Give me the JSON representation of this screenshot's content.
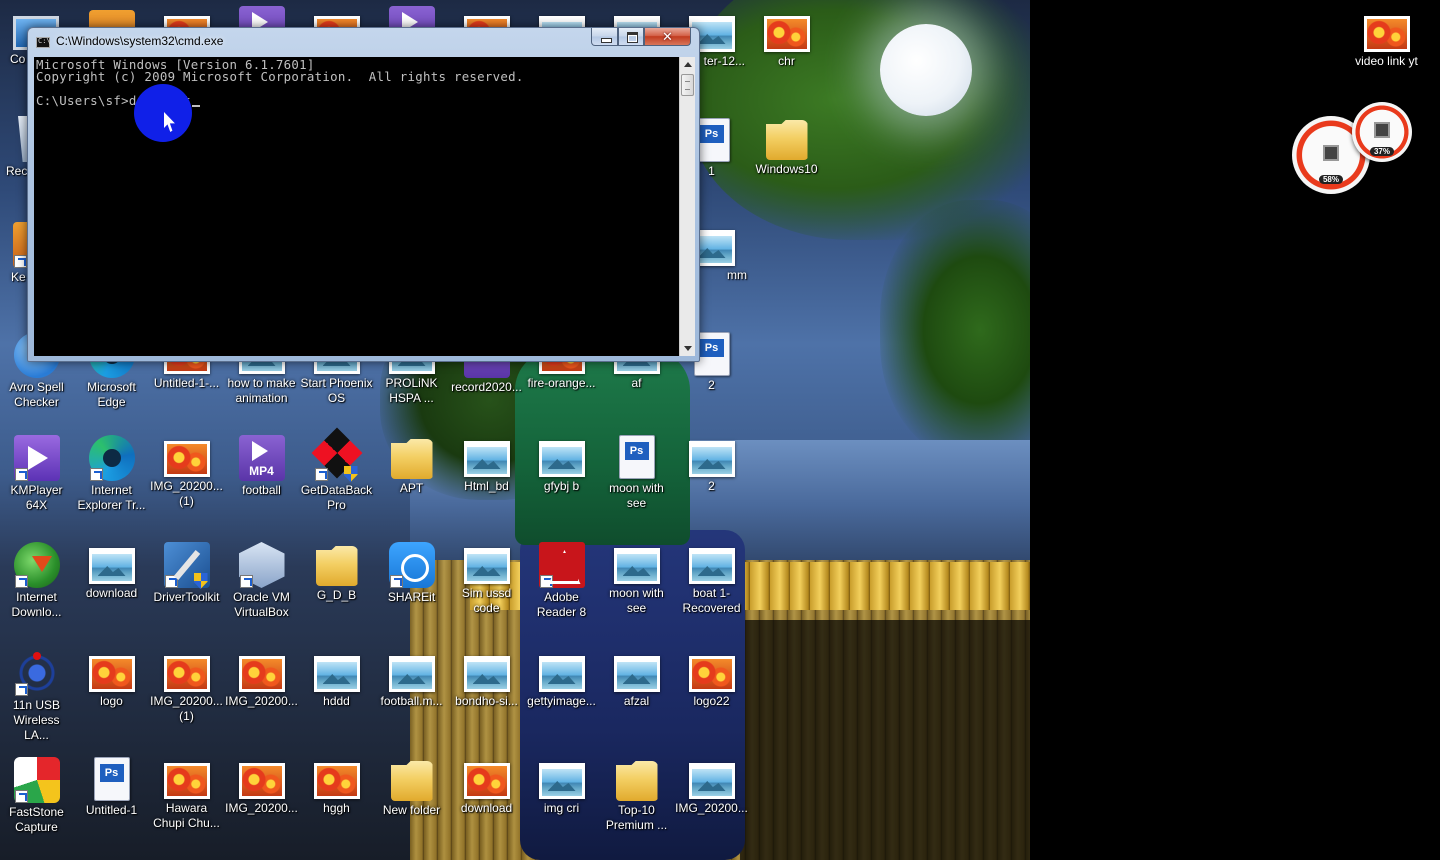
{
  "cmd": {
    "title": "C:\\Windows\\system32\\cmd.exe",
    "line1": "Microsoft Windows [Version 6.1.7601]",
    "line2": "Copyright (c) 2009 Microsoft Corporation.  All rights reserved.",
    "prompt": "C:\\Users\\sf>",
    "typed": "diskpart"
  },
  "gadget": {
    "cpu_percent": "58%",
    "memory_percent": "37%"
  },
  "icons": {
    "computer": "Co",
    "recycle": "Rec",
    "ke": "Ke",
    "after12": "ter-12...",
    "chr": "chr",
    "video_link": "video link yt",
    "ps1": "1",
    "windows10": "Windows10",
    "mmm": "mm",
    "avro": "Avro Spell Checker",
    "edge": "Microsoft Edge",
    "untitled1": "Untitled-1-...",
    "howto": "how to make animation",
    "phoenix": "Start Phoenix OS",
    "prolink": "PROLiNK HSPA ...",
    "record": "record2020...",
    "fireorange": "fire-orange...",
    "af": "af",
    "ps2": "2",
    "kmplayer": "KMPlayer 64X",
    "ie": "Internet Explorer Tr...",
    "img1": "IMG_20200... (1)",
    "football": "football",
    "getdata": "GetDataBack Pro",
    "apt": "APT",
    "html": "Html_bd",
    "gfybj": "gfybj b",
    "moon1": "moon with see",
    "two": "2",
    "idm": "Internet Downlo...",
    "download1": "download",
    "drivertoolkit": "DriverToolkit",
    "oracle": "Oracle VM VirtualBox",
    "gdb": "G_D_B",
    "shareit": "SHAREit",
    "simussd": "Sim ussd code",
    "adobe": "Adobe Reader 8",
    "moon2": "moon with see",
    "boat": "boat 1-Recovered",
    "usb": "11n USB Wireless LA...",
    "logo": "logo",
    "img2": "IMG_20200... (1)",
    "img3": "IMG_20200...",
    "hddd": "hddd",
    "footballm": "football.m...",
    "bondho": "bondho-si...",
    "getty": "gettyimage...",
    "afzal": "afzal",
    "logo22": "logo22",
    "faststone": "FastStone Capture",
    "untitled": "Untitled-1",
    "hawara": "Hawara Chupi Chu...",
    "img4": "IMG_20200...",
    "hggh": "hggh",
    "newfolder": "New folder",
    "download2": "download",
    "imgcri": "img cri",
    "top10": "Top-10 Premium ...",
    "img5": "IMG_20200..."
  }
}
